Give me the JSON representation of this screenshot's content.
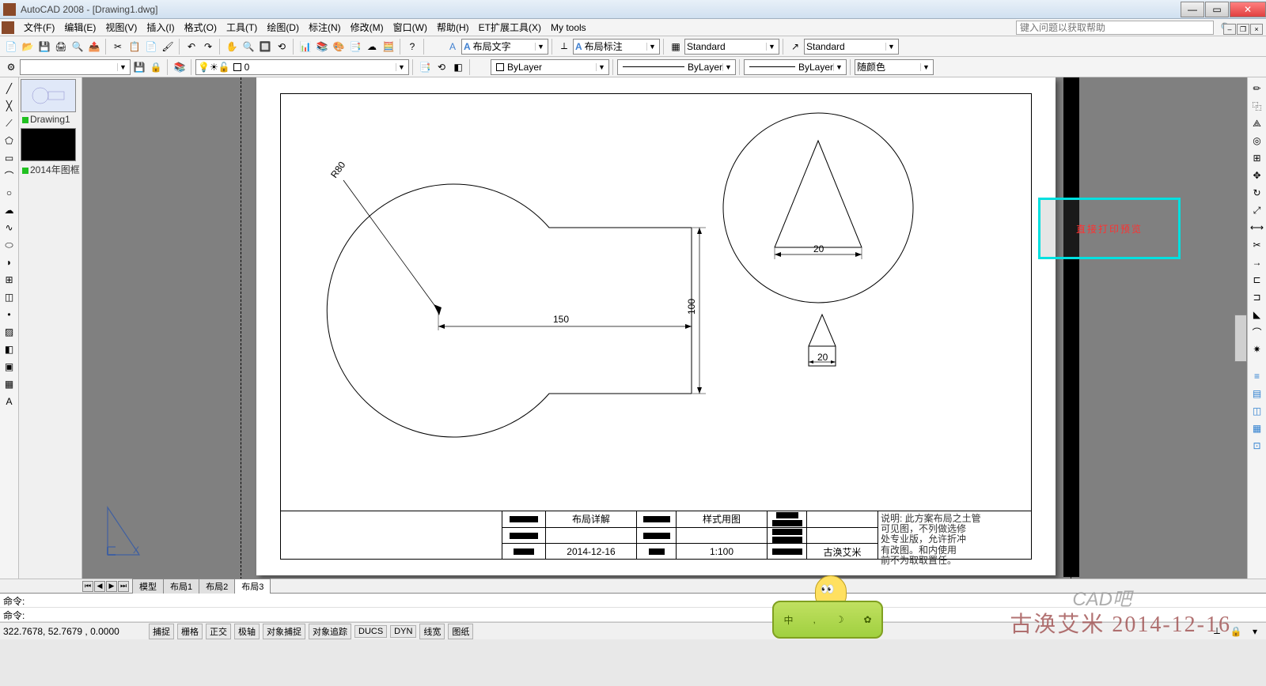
{
  "title": "AutoCAD 2008 - [Drawing1.dwg]",
  "help_placeholder": "键入问题以获取帮助",
  "menu": [
    "文件(F)",
    "编辑(E)",
    "视图(V)",
    "插入(I)",
    "格式(O)",
    "工具(T)",
    "绘图(D)",
    "标注(N)",
    "修改(M)",
    "窗口(W)",
    "帮助(H)",
    "ET扩展工具(X)",
    "My tools"
  ],
  "toolbar2": {
    "text_style": "布局文字",
    "dim_style": "布局标注",
    "table_style": "Standard",
    "std2": "Standard"
  },
  "toolbar3": {
    "layer": "0",
    "current_layer": "ByLayer",
    "linetype": "ByLayer",
    "lineweight": "ByLayer",
    "color": "随颜色"
  },
  "thumbs": {
    "name1": "Drawing1",
    "name2": "2014年图框"
  },
  "tabs": [
    "模型",
    "布局1",
    "布局2",
    "布局3"
  ],
  "active_tab": 3,
  "drawing": {
    "r_label": "R80",
    "dim_h": "150",
    "dim_v": "100",
    "dim_20a": "20",
    "dim_20b": "20"
  },
  "title_block": {
    "c2r1": "布局详解",
    "c2r3": "2014-12-16",
    "c4r1": "样式用图",
    "c4r3": "1:100",
    "c6r3": "古涣艾米"
  },
  "callout": "直接打印预览",
  "cmd1": "命令:",
  "cmd2": "命令:",
  "status": {
    "coords": "322.7678, 52.7679 , 0.0000",
    "buttons": [
      "捕捉",
      "栅格",
      "正交",
      "极轴",
      "对象捕捉",
      "对象追踪",
      "DUCS",
      "DYN",
      "线宽",
      "图纸"
    ]
  },
  "watermark": "古涣艾米 2014-12-16",
  "watermark_logo": "CAD吧",
  "minion": {
    "left": "中",
    "mid": "☽",
    "right": "✿"
  }
}
